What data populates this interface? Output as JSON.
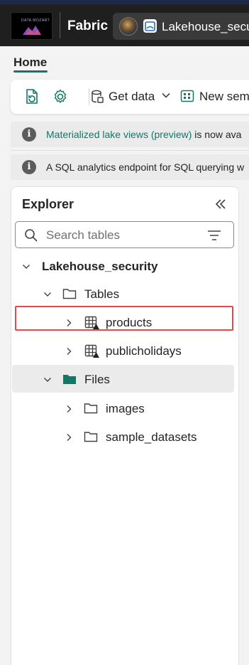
{
  "topbar": {
    "logo_text": "DATA MOZART",
    "brand": "Fabric",
    "tab_label": "Lakehouse_secu"
  },
  "ribbon": {
    "home_tab": "Home",
    "get_data_label": "Get data",
    "new_semantic_label": "New sem"
  },
  "banners": {
    "first_link": "Materialized lake views (preview)",
    "first_rest": " is now ava",
    "second_text": "A SQL analytics endpoint for SQL querying w"
  },
  "explorer": {
    "title": "Explorer",
    "search_placeholder": "Search tables",
    "lakehouse": "Lakehouse_security",
    "tables_folder": "Tables",
    "tables": [
      "products",
      "publicholidays"
    ],
    "files_folder": "Files",
    "files": [
      "images",
      "sample_datasets"
    ]
  },
  "colors": {
    "accent": "#117865",
    "highlight_border": "#e04b4b",
    "topbar_bg": "#1f1f1f"
  }
}
